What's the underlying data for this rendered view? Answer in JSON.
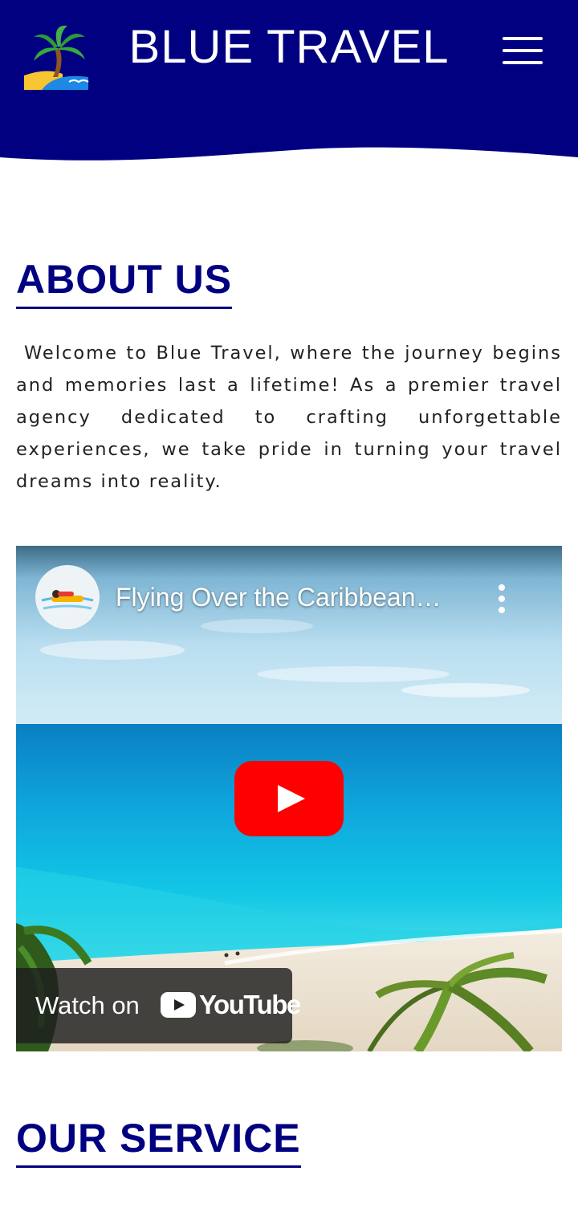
{
  "header": {
    "brand": "BLUE TRAVEL",
    "logo_icon": "palm-beach-icon",
    "menu_icon": "hamburger-menu-icon",
    "background_color": "#000080"
  },
  "about": {
    "title": "ABOUT US",
    "text": "Welcome to Blue Travel, where the journey begins and memories last a lifetime! As a premier travel agency dedicated to crafting unforgettable experiences, we take pride in turning your travel dreams into reality."
  },
  "video": {
    "title": "Flying Over the Caribbean…",
    "channel_icon": "channel-avatar-icon",
    "more_icon": "more-vert-icon",
    "play_icon": "youtube-play-icon",
    "watch_label": "Watch on",
    "platform": "YouTube"
  },
  "services": {
    "title": "OUR SERVICE"
  },
  "colors": {
    "accent": "#000080",
    "play_red": "#ff0000"
  }
}
